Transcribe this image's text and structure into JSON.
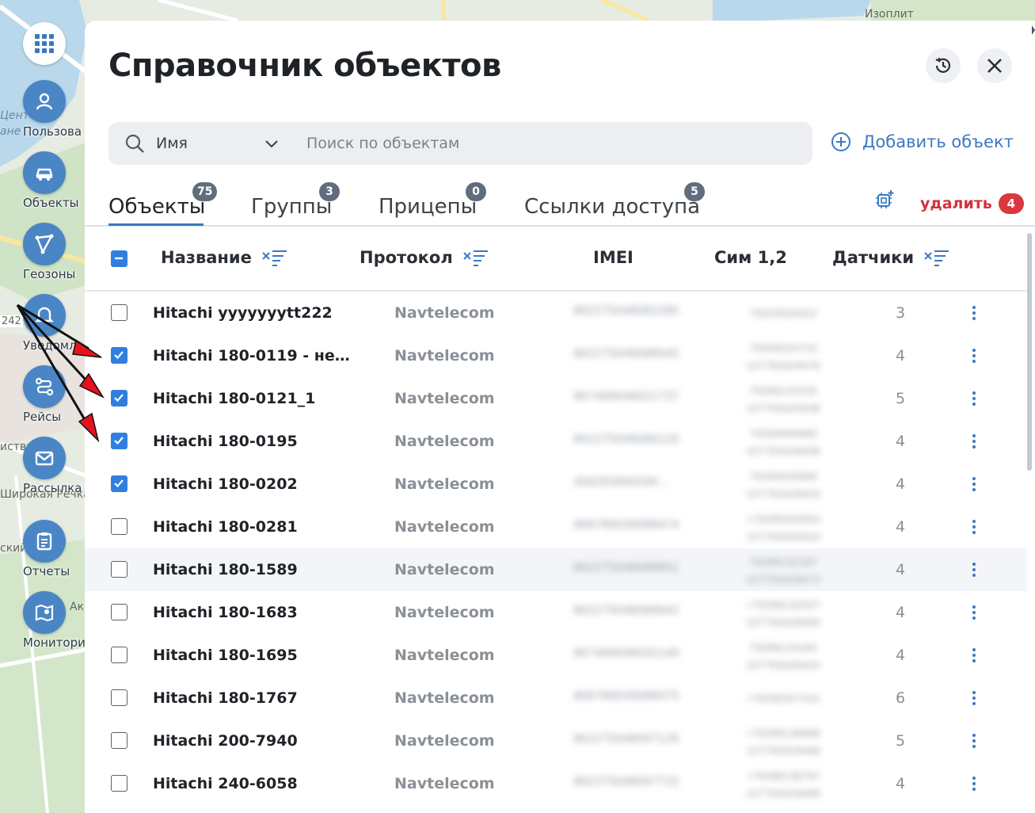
{
  "map": {
    "labels": [
      "Изоплит",
      "242",
      "иства",
      "Широкая Речка",
      "ский",
      "Ак",
      "Цент",
      "ане"
    ]
  },
  "sidebar": {
    "items": [
      {
        "label": "Пользова",
        "icon": "user-icon"
      },
      {
        "label": "Объекты",
        "icon": "car-icon"
      },
      {
        "label": "Геозоны",
        "icon": "geozone-icon"
      },
      {
        "label": "Уведомл",
        "icon": "bell-icon"
      },
      {
        "label": "Рейсы",
        "icon": "route-icon"
      },
      {
        "label": "Рассылка",
        "icon": "mail-icon"
      },
      {
        "label": "Отчеты",
        "icon": "report-icon"
      },
      {
        "label": "Монитори",
        "icon": "map-pin-icon"
      }
    ]
  },
  "panel": {
    "title": "Справочник объектов",
    "search": {
      "field": "Имя",
      "placeholder": "Поиск по объектам"
    },
    "add_label": "Добавить объект",
    "tabs": [
      {
        "label": "Объекты",
        "count": "75"
      },
      {
        "label": "Группы",
        "count": "3"
      },
      {
        "label": "Прицепы",
        "count": "0"
      },
      {
        "label": "Ссылки доступа",
        "count": "5"
      }
    ],
    "delete_label": "удалить",
    "delete_count": "4",
    "columns": {
      "name": "Название",
      "protocol": "Протокол",
      "imei": "IMEI",
      "sim": "Сим 1,2",
      "sensors": "Датчики"
    },
    "rows": [
      {
        "name": "Hitachi yyyyyyytt222",
        "protocol": "Navtelecom",
        "imei": "862275048082285",
        "sim": [
          "79203928422"
        ],
        "sensors": "3",
        "checked": false
      },
      {
        "name": "Hitachi 180-0119 - непр…",
        "protocol": "Navtelecom",
        "imei": "862275048088945",
        "sim": [
          "79289324716",
          "107783429478"
        ],
        "sensors": "4",
        "checked": true
      },
      {
        "name": "Hitachi 180-0121_1",
        "protocol": "Navtelecom",
        "imei": "867489048021737",
        "sim": [
          "79288133150",
          "107783429438"
        ],
        "sensors": "5",
        "checked": true
      },
      {
        "name": "Hitachi 180-0195",
        "protocol": "Navtelecom",
        "imei": "862275048086120",
        "sim": [
          "79289998989",
          "107783428438"
        ],
        "sensors": "4",
        "checked": true
      },
      {
        "name": "Hitachi 180-0202",
        "protocol": "Navtelecom",
        "imei": "358283069299…",
        "sim": [
          "79289328989",
          "107783428424"
        ],
        "sensors": "4",
        "checked": true
      },
      {
        "name": "Hitachi 180-0281",
        "protocol": "Navtelecom",
        "imei": "868789039088474",
        "sim": [
          "+79289332853",
          "107783428424"
        ],
        "sensors": "4",
        "checked": false
      },
      {
        "name": "Hitachi 180-1589",
        "protocol": "Navtelecom",
        "imei": "862275048088851",
        "sim": [
          "79288132187",
          "107783428473"
        ],
        "sensors": "4",
        "checked": false
      },
      {
        "name": "Hitachi 180-1683",
        "protocol": "Navtelecom",
        "imei": "862275048088842",
        "sim": [
          "+79288132927",
          "107783428494"
        ],
        "sensors": "4",
        "checked": false
      },
      {
        "name": "Hitachi 180-1695",
        "protocol": "Navtelecom",
        "imei": "867489048032149",
        "sim": [
          "79288133183",
          "107783428424"
        ],
        "sensors": "4",
        "checked": false
      },
      {
        "name": "Hitachi 180-1767",
        "protocol": "Navtelecom",
        "imei": "868789039088475",
        "sim": [
          "+79289327431"
        ],
        "sensors": "6",
        "checked": false
      },
      {
        "name": "Hitachi 200-7940",
        "protocol": "Navtelecom",
        "imei": "862275048097126",
        "sim": [
          "+79288138688",
          "107783428488"
        ],
        "sensors": "5",
        "checked": false
      },
      {
        "name": "Hitachi 240-6058",
        "protocol": "Navtelecom",
        "imei": "862275048097722",
        "sim": [
          "+79288138787",
          "107783428488"
        ],
        "sensors": "4",
        "checked": false
      }
    ]
  },
  "colors": {
    "accent": "#3a78c2",
    "sidebar_icon": "#4a86c5",
    "danger": "#d9383f",
    "checkbox": "#2f7fe0",
    "annotation_arrow": "#e5131d"
  }
}
